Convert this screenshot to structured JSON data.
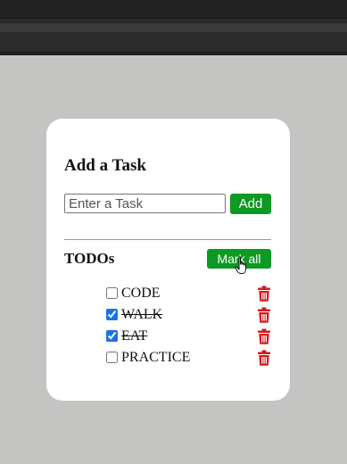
{
  "card": {
    "title": "Add a Task",
    "input": {
      "placeholder": "Enter a Task",
      "value": ""
    },
    "add_label": "Add",
    "todos_title": "TODOs",
    "mark_all_label": "Mark all"
  },
  "todos": [
    {
      "text": "CODE",
      "checked": false
    },
    {
      "text": "WALK",
      "checked": true
    },
    {
      "text": "EAT",
      "checked": true
    },
    {
      "text": "PRACTICE",
      "checked": false
    }
  ],
  "colors": {
    "background": "#c4c5c3",
    "card": "#ffffff",
    "button_green": "#0d9a22",
    "trash_red": "#d01c1c",
    "checkbox_blue": "#1a73e8"
  },
  "icons": {
    "delete": "trash-icon",
    "pointer": "hand-cursor-icon"
  }
}
